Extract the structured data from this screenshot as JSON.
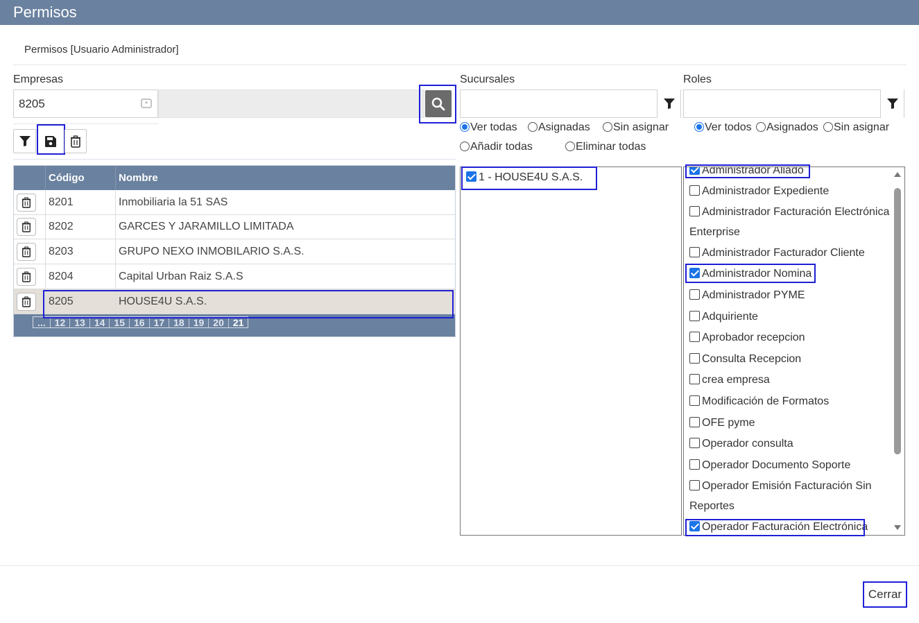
{
  "window": {
    "title": "Permisos"
  },
  "subtitle": "Permisos [Usuario Administrador]",
  "empresas": {
    "label": "Empresas",
    "code_value": "8205",
    "name_value": "",
    "grid": {
      "headers": {
        "codigo": "Código",
        "nombre": "Nombre"
      },
      "rows": [
        {
          "codigo": "8201",
          "nombre": "Inmobiliaria la 51 SAS"
        },
        {
          "codigo": "8202",
          "nombre": "GARCES Y JARAMILLO LIMITADA"
        },
        {
          "codigo": "8203",
          "nombre": "GRUPO NEXO INMOBILARIO S.A.S."
        },
        {
          "codigo": "8204",
          "nombre": "Capital Urban Raiz S.A.S"
        },
        {
          "codigo": "8205",
          "nombre": "HOUSE4U S.A.S."
        }
      ],
      "pages": [
        "...",
        "12",
        "13",
        "14",
        "15",
        "16",
        "17",
        "18",
        "19",
        "20",
        "21"
      ],
      "current_page": "21"
    }
  },
  "sucursales": {
    "label": "Sucursales",
    "filter_value": "",
    "radios": {
      "ver_todas": "Ver todas",
      "asignadas": "Asignadas",
      "sin_asignar": "Sin asignar",
      "anadir_todas": "Añadir todas",
      "eliminar_todas": "Eliminar todas"
    },
    "items": [
      {
        "label": "1 - HOUSE4U S.A.S.",
        "checked": true
      }
    ]
  },
  "roles": {
    "label": "Roles",
    "filter_value": "",
    "radios": {
      "ver_todos": "Ver todos",
      "asignados": "Asignados",
      "sin_asignar": "Sin asignar"
    },
    "items": [
      {
        "label": "Administrador Aliado",
        "checked": true
      },
      {
        "label": "Administrador Expediente",
        "checked": false
      },
      {
        "label": "Administrador Facturación Electrónica",
        "cont": "Enterprise",
        "checked": false
      },
      {
        "label": "Administrador Facturador Cliente",
        "checked": false
      },
      {
        "label": "Administrador Nomina",
        "checked": true
      },
      {
        "label": "Administrador PYME",
        "checked": false
      },
      {
        "label": "Adquiriente",
        "checked": false
      },
      {
        "label": "Aprobador recepcion",
        "checked": false
      },
      {
        "label": "Consulta Recepcion",
        "checked": false
      },
      {
        "label": "crea empresa",
        "checked": false
      },
      {
        "label": "Modificación de Formatos",
        "checked": false
      },
      {
        "label": "OFE pyme",
        "checked": false
      },
      {
        "label": "Operador consulta",
        "checked": false
      },
      {
        "label": "Operador Documento Soporte",
        "checked": false
      },
      {
        "label": "Operador Emisión Facturación Sin",
        "cont": "Reportes",
        "checked": false
      },
      {
        "label": "Operador Facturación Electrónica",
        "checked": true
      }
    ]
  },
  "footer": {
    "close_label": "Cerrar"
  },
  "colors": {
    "header_bg": "#6a819f",
    "highlight": "#1f1fd6",
    "check": "#1a73e8"
  }
}
